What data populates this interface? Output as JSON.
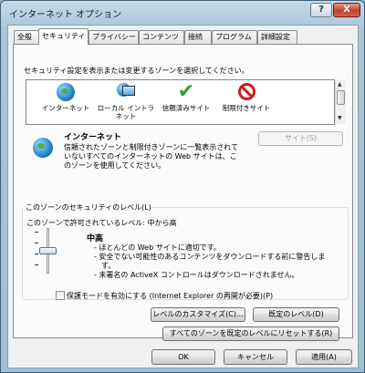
{
  "window": {
    "title": "インターネット オプション",
    "help_label": "?",
    "close_label": "X"
  },
  "tabs": [
    {
      "label": "全般",
      "active": false
    },
    {
      "label": "セキュリティ",
      "active": true
    },
    {
      "label": "プライバシー",
      "active": false
    },
    {
      "label": "コンテンツ",
      "active": false
    },
    {
      "label": "接続",
      "active": false
    },
    {
      "label": "プログラム",
      "active": false
    },
    {
      "label": "詳細設定",
      "active": false
    }
  ],
  "security": {
    "prompt": "セキュリティ設定を表示または変更するゾーンを選択してください。",
    "zones": [
      {
        "label": "インターネット",
        "icon": "globe-icon"
      },
      {
        "label": "ローカル イントラネット",
        "icon": "intranet-icon"
      },
      {
        "label": "信頼済みサイト",
        "icon": "checkmark-icon"
      },
      {
        "label": "制限付きサイト",
        "icon": "no-entry-icon"
      }
    ],
    "selected_zone": {
      "name": "インターネット",
      "description_lines": [
        "信頼されたゾーンと制限付きゾーンに一覧表示されて",
        "いないすべてのインターネットの Web サイトは、こ",
        "のゾーンを使用してください。"
      ]
    },
    "sites_button": "サイト(S)",
    "level_group": {
      "title": "このゾーンのセキュリティのレベル(L)",
      "allowed_levels": "このゾーンで許可されているレベル: 中から高",
      "current_level": "中高",
      "bullets": [
        "- ほとんどの Web サイトに適切です。",
        "- 安全でない可能性のあるコンテンツをダウンロードする前に警告しま",
        "す。",
        "- 未署名の ActiveX コントロールはダウンロードされません。"
      ],
      "slider_level_fraction": 0.6
    },
    "protected_mode": {
      "label": "保護モードを有効にする (Internet Explorer の再開が必要)(P)",
      "checked": false
    },
    "custom_level_button": "レベルのカスタマイズ(C)...",
    "default_level_button": "既定のレベル(D)",
    "reset_all_button": "すべてのゾーンを既定のレベルにリセットする(R)"
  },
  "footer": {
    "ok": "OK",
    "cancel": "キャンセル",
    "apply": "適用(A)"
  }
}
